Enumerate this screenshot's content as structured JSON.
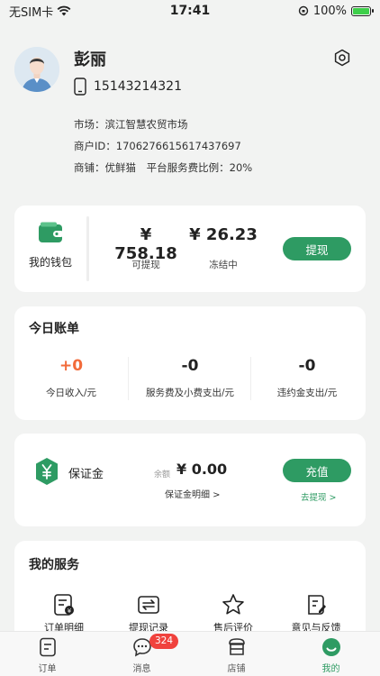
{
  "status_bar": {
    "carrier": "无SIM卡",
    "time": "17:41",
    "battery": "100%",
    "battery_level": 1.0
  },
  "profile": {
    "name": "彭丽",
    "phone": "15143214321",
    "market": "市场：滨江智慧农贸市场",
    "merchant_id": "商户ID：1706276615617437697",
    "shop": "商铺：优鲜猫",
    "service_rate": "平台服务费比例：20%"
  },
  "wallet": {
    "label": "我的钱包",
    "withdrawable_amount": "¥ 758.18",
    "withdrawable_label": "可提现",
    "frozen_amount": "¥ 26.23",
    "frozen_label": "冻结中",
    "withdraw_button": "提现"
  },
  "today_bill": {
    "title": "今日账单",
    "stats": [
      {
        "value": "+0",
        "label": "今日收入/元",
        "color": "#f26b3a"
      },
      {
        "value": "-0",
        "label": "服务费及小费支出/元",
        "color": "#222222"
      },
      {
        "value": "-0",
        "label": "违约金支出/元",
        "color": "#222222"
      }
    ]
  },
  "deposit": {
    "label": "保证金",
    "balance_caption": "余额",
    "balance": "¥ 0.00",
    "detail_link": "保证金明细 >",
    "recharge_button": "充值",
    "withdraw_link": "去提现 >"
  },
  "services": {
    "title": "我的服务",
    "items": [
      {
        "label": "订单明细",
        "icon": "order-detail-icon"
      },
      {
        "label": "提现记录",
        "icon": "withdraw-record-icon"
      },
      {
        "label": "售后评价",
        "icon": "star-icon"
      },
      {
        "label": "意见与反馈",
        "icon": "feedback-icon"
      }
    ]
  },
  "tabbar": {
    "tabs": [
      {
        "label": "订单",
        "icon": "order-icon"
      },
      {
        "label": "消息",
        "icon": "message-icon",
        "badge": "324"
      },
      {
        "label": "店铺",
        "icon": "shop-icon"
      },
      {
        "label": "我的",
        "icon": "profile-icon",
        "active": true
      }
    ]
  },
  "colors": {
    "accent": "#2e9b63",
    "income": "#f26b3a",
    "badge": "#f0423d"
  }
}
